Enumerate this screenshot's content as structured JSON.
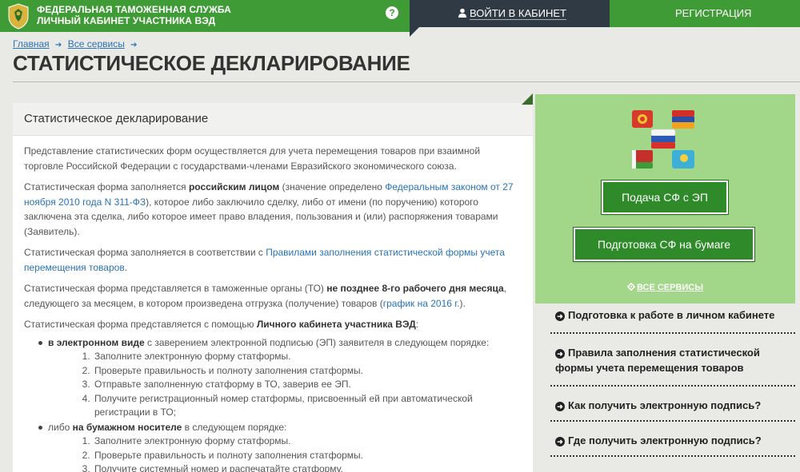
{
  "header": {
    "org_line1": "ФЕДЕРАЛЬНАЯ ТАМОЖЕННАЯ СЛУЖБА",
    "org_line2": "ЛИЧНЫЙ КАБИНЕТ УЧАСТНИКА ВЭД",
    "help_label": "?",
    "login_label": "ВОЙТИ В КАБИНЕТ",
    "register_label": "РЕГИСТРАЦИЯ",
    "brand_color": "#3f9b35",
    "dark_color": "#2f3a44",
    "logo_icon": "eagle-emblem-icon",
    "login_icon": "user-icon"
  },
  "breadcrumb": {
    "home": "Главная",
    "services": "Все сервисы"
  },
  "page_title": "СТАТИСТИЧЕСКОЕ ДЕКЛАРИРОВАНИЕ",
  "content": {
    "heading": "Статистическое декларирование",
    "p1": "Представление статистических форм осуществляется для учета перемещения товаров при взаимной торговле Российской Федерации с государствами-членами Евразийского экономического союза.",
    "p2_a": "Статистическая форма заполняется ",
    "p2_b": "российским лицом",
    "p2_c": " (значение определено ",
    "p2_link": "Федеральным законом от 27 ноября 2010 года N 311-ФЗ",
    "p2_d": "), которое либо заключило сделку, либо от имени (по поручению) которого заключена эта сделка, либо которое имеет право владения, пользования и (или) распоряжения товарами (Заявитель).",
    "p3_a": "Статистическая форма заполняется в соответствии с ",
    "p3_link": "Правилами заполнения статистической формы учета перемещения товаров",
    "p3_b": ".",
    "p4_a": "Статистическая форма представляется в таможенные органы (ТО) ",
    "p4_b": "не позднее 8-го рабочего дня месяца",
    "p4_c": ", следующего за месяцем, в котором произведена отгрузка (получение) товаров (",
    "p4_link": "график на 2016 г.",
    "p4_d": ").",
    "p5_a": "Статистическая форма представляется с помощью ",
    "p5_b": "Личного кабинета участника ВЭД",
    "p5_c": ":",
    "electronic_a": "в электронном виде",
    "electronic_b": " с заверением электронной подписью (ЭП) заявителя в следующем порядке:",
    "electronic_steps": [
      "Заполните электронную форму статформы.",
      "Проверьте правильность и полноту заполнения статформы.",
      "Отправьте заполненную статформу в ТО, заверив ее ЭП.",
      "Получите регистрационный номер статформы, присвоенный ей при автоматической регистрации в ТО;"
    ],
    "paper_a": "либо ",
    "paper_b": "на бумажном носителе",
    "paper_c": " в следующем порядке:",
    "paper_steps": [
      "Заполните электронную форму статформы.",
      "Проверьте правильность и полноту заполнения статформы.",
      "Получите системный номер и распечатайте статформу."
    ]
  },
  "panel": {
    "btn_electronic": "Подача СФ с ЭП",
    "btn_paper": "Подготовка СФ на бумаге",
    "all_services": "ВСЕ СЕРВИСЫ",
    "flags_icon": "eaeu-flags-icon",
    "panel_color": "#a2d78a"
  },
  "side_links": [
    "Подготовка к работе в личном кабинете",
    "Правила заполнения статистической формы учета перемещения товаров",
    "Как получить электронную подпись?",
    "Где получить электронную подпись?"
  ]
}
